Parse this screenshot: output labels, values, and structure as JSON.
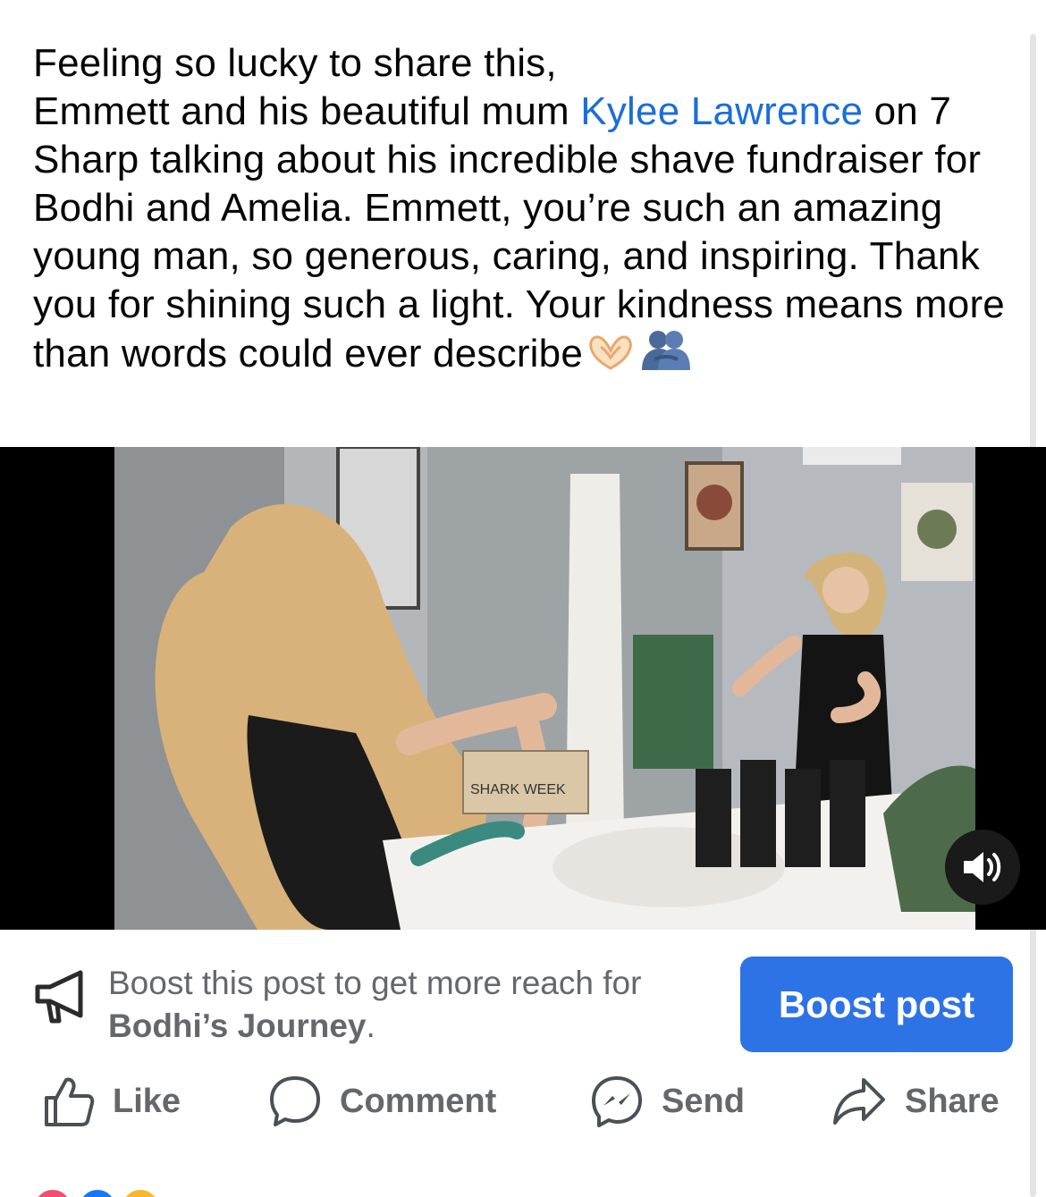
{
  "post": {
    "text_before_mention": "Feeling so lucky to share this,\nEmmett and his beautiful mum ",
    "mention": "Kylee Lawrence",
    "text_after_mention": " on 7 Sharp talking about his incredible shave fundraiser for Bodhi and Amelia. Emmett, you’re such an amazing young man, so generous, caring, and inspiring. Thank you for shining such a light. Your kindness means more than words could ever describe",
    "emojis": [
      "heart-hands-icon",
      "hugging-people-icon"
    ]
  },
  "video": {
    "box_label": "SHARK WEEK",
    "mute_icon": "speaker-icon"
  },
  "boost": {
    "prompt": "Boost this post to get more reach for ",
    "page_name": "Bodhi’s Journey",
    "suffix": ".",
    "button_label": "Boost post"
  },
  "actions": {
    "like": "Like",
    "comment": "Comment",
    "send": "Send",
    "share": "Share"
  },
  "colors": {
    "mention": "#1a6ed8",
    "boost_button": "#2d73e6",
    "secondary_text": "#65676b"
  }
}
